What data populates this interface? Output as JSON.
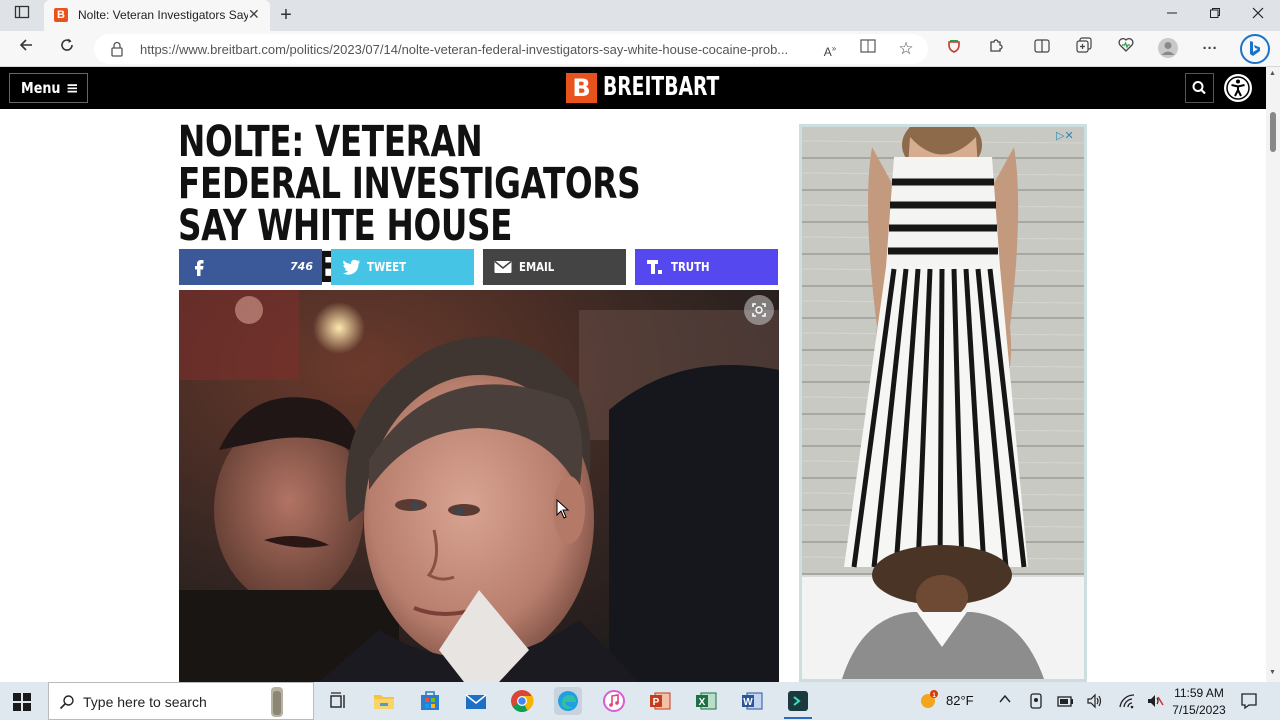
{
  "browser": {
    "tab_title": "Nolte: Veteran Investigators Say White House Cocaine Probe",
    "favicon_letter": "B",
    "url": "https://www.breitbart.com/politics/2023/07/14/nolte-veteran-federal-investigators-say-white-house-cocaine-prob..."
  },
  "site": {
    "menu_label": "Menu",
    "logo_letter": "B",
    "logo_text": "BREITBART",
    "accent": "#e8531d"
  },
  "article": {
    "headline": "NOLTE: VETERAN FEDERAL INVESTIGATORS SAY WHITE HOUSE COCAINE PROBE A ‘COVER UP’",
    "share": {
      "facebook_count": "746",
      "tweet_label": "TWEET",
      "email_label": "EMAIL",
      "truth_label": "TRUTH"
    },
    "colors": {
      "facebook": "#3b5998",
      "twitter": "#45c4e5",
      "email": "#444444",
      "truth": "#5448ee"
    }
  },
  "taskbar": {
    "search_placeholder": "Type here to search",
    "weather": "82°F",
    "time": "11:59 AM",
    "date": "7/15/2023"
  }
}
